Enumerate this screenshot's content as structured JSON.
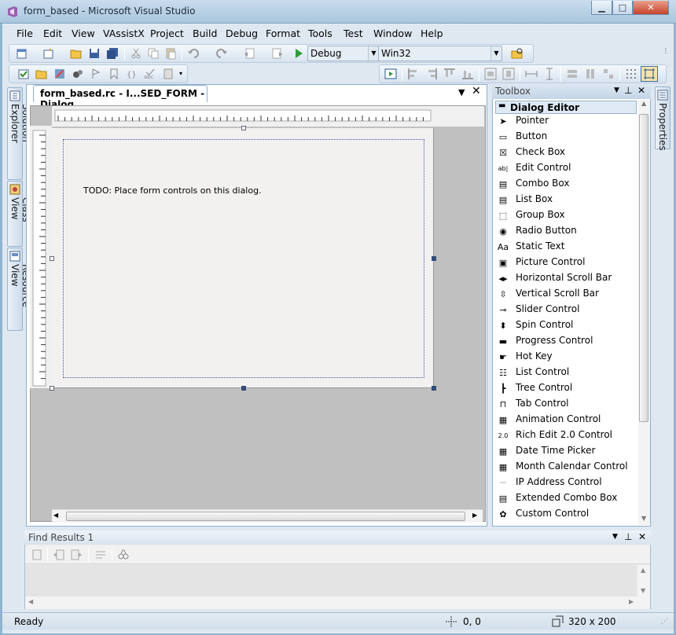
{
  "window": {
    "title": "form_based - Microsoft Visual Studio",
    "minimize_label": "▁",
    "maximize_label": "□",
    "close_label": "✕"
  },
  "menu": [
    "File",
    "Edit",
    "View",
    "VAssistX",
    "Project",
    "Build",
    "Debug",
    "Format",
    "Tools",
    "Test",
    "Window",
    "Help"
  ],
  "toolbar": {
    "config": "Debug",
    "platform": "Win32"
  },
  "side_tabs": [
    "Solution Explorer",
    "Class View",
    "Resource View"
  ],
  "document": {
    "tab_title": "form_based.rc - I...SED_FORM - Dialog",
    "todo_text": "TODO: Place form controls on this dialog."
  },
  "toolbox": {
    "title": "Toolbox",
    "group": "Dialog Editor",
    "items": [
      {
        "label": "Pointer",
        "icon": "pointer-icon",
        "glyph": "➤"
      },
      {
        "label": "Button",
        "icon": "button-icon",
        "glyph": "▭"
      },
      {
        "label": "Check Box",
        "icon": "checkbox-icon",
        "glyph": "☒"
      },
      {
        "label": "Edit Control",
        "icon": "edit-control-icon",
        "glyph": "ab|"
      },
      {
        "label": "Combo Box",
        "icon": "combo-box-icon",
        "glyph": "▤"
      },
      {
        "label": "List Box",
        "icon": "list-box-icon",
        "glyph": "▤"
      },
      {
        "label": "Group Box",
        "icon": "group-box-icon",
        "glyph": "⬚"
      },
      {
        "label": "Radio Button",
        "icon": "radio-button-icon",
        "glyph": "◉"
      },
      {
        "label": "Static Text",
        "icon": "static-text-icon",
        "glyph": "Aa"
      },
      {
        "label": "Picture Control",
        "icon": "picture-control-icon",
        "glyph": "▣"
      },
      {
        "label": "Horizontal Scroll Bar",
        "icon": "hscroll-icon",
        "glyph": "◂▸"
      },
      {
        "label": "Vertical Scroll Bar",
        "icon": "vscroll-icon",
        "glyph": "⇳"
      },
      {
        "label": "Slider Control",
        "icon": "slider-icon",
        "glyph": "⊸"
      },
      {
        "label": "Spin Control",
        "icon": "spin-icon",
        "glyph": "⬍"
      },
      {
        "label": "Progress Control",
        "icon": "progress-icon",
        "glyph": "▬"
      },
      {
        "label": "Hot Key",
        "icon": "hot-key-icon",
        "glyph": "☛"
      },
      {
        "label": "List Control",
        "icon": "list-control-icon",
        "glyph": "☷"
      },
      {
        "label": "Tree Control",
        "icon": "tree-control-icon",
        "glyph": "┣"
      },
      {
        "label": "Tab Control",
        "icon": "tab-control-icon",
        "glyph": "⊓"
      },
      {
        "label": "Animation Control",
        "icon": "animation-icon",
        "glyph": "▦"
      },
      {
        "label": "Rich Edit 2.0 Control",
        "icon": "rich-edit-icon",
        "glyph": "2.0"
      },
      {
        "label": "Date Time Picker",
        "icon": "date-time-icon",
        "glyph": "▦"
      },
      {
        "label": "Month Calendar Control",
        "icon": "month-calendar-icon",
        "glyph": "▦"
      },
      {
        "label": "IP Address Control",
        "icon": "ip-address-icon",
        "glyph": "···"
      },
      {
        "label": "Extended Combo Box",
        "icon": "extended-combo-icon",
        "glyph": "▤"
      },
      {
        "label": "Custom Control",
        "icon": "custom-control-icon",
        "glyph": "✿"
      }
    ]
  },
  "properties_tab": "Properties",
  "find_results": {
    "title": "Find Results 1"
  },
  "status": {
    "text": "Ready",
    "position": "0, 0",
    "size": "320 x 200"
  }
}
